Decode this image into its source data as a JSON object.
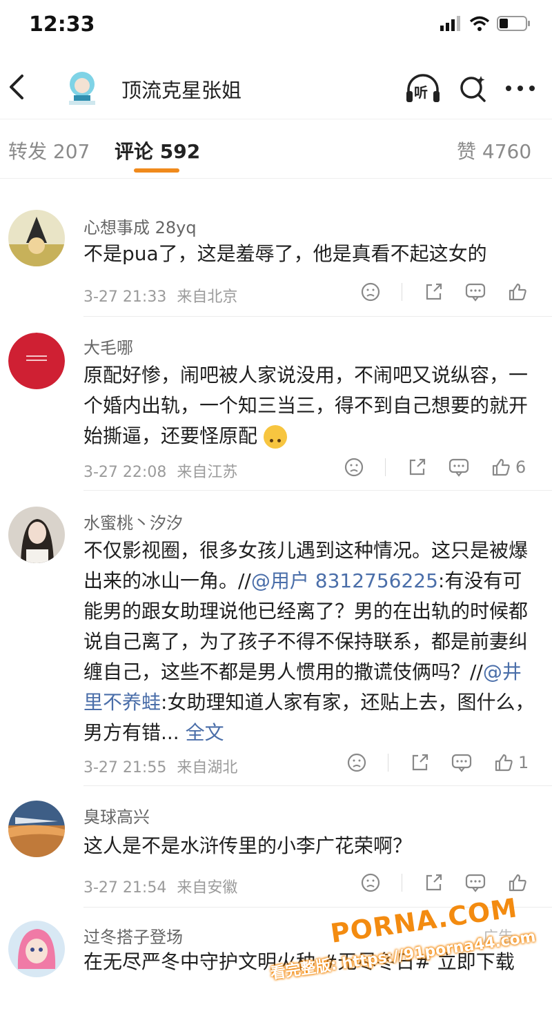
{
  "status": {
    "time": "12:33"
  },
  "header": {
    "title": "顶流克星张姐",
    "listen": "听"
  },
  "tabs": [
    {
      "label": "转发 207"
    },
    {
      "label": "评论 592"
    },
    {
      "label": "赞 4760"
    }
  ],
  "comments": [
    {
      "name": "心想事成 28yq",
      "text": "不是pua了，这是羞辱了，他是真看不起这女的",
      "time": "3-27 21:33",
      "loc": "来自北京",
      "likes": ""
    },
    {
      "name": "大毛哪",
      "text": "原配好惨，闹吧被人家说没用，不闹吧又说纵容，一个婚内出轨，一个知三当三，得不到自己想要的就开始撕逼，还要怪原配",
      "time": "3-27 22:08",
      "loc": "来自江苏",
      "likes": "6"
    },
    {
      "name": "水蜜桃丶汐汐",
      "text_a": "不仅影视圈，很多女孩儿遇到这种情况。这只是被爆出来的冰山一角。//",
      "mention_a": "@用户 8312756225",
      "text_b": ":有没有可能男的跟女助理说他已经离了？男的在出轨的时候都说自己离了，为了孩子不得不保持联系，都是前妻纠缠自己，这些不都是男人惯用的撒谎伎俩吗？//",
      "mention_b": "@井里不养蛙",
      "text_c": ":女助理知道人家有家，还贴上去，图什么，男方有错...",
      "more": "全文",
      "time": "3-27 21:55",
      "loc": "来自湖北",
      "likes": "1"
    },
    {
      "name": "臭球高兴",
      "text": "这人是不是水浒传里的小李广花荣啊？",
      "time": "3-27 21:54",
      "loc": "来自安徽",
      "likes": ""
    },
    {
      "name": "过冬搭子登场",
      "text": "在无尽严冬中守护文明火种 #无尽冬日# 立即下载",
      "ad_label": "广告"
    }
  ],
  "watermark": {
    "brand": "PORNA.COM",
    "line": "看完整版: https://91porna44.com"
  },
  "colors": {
    "accent": "#f08a1c",
    "mention": "#4a6ea9",
    "watermark": "#f38b10"
  }
}
